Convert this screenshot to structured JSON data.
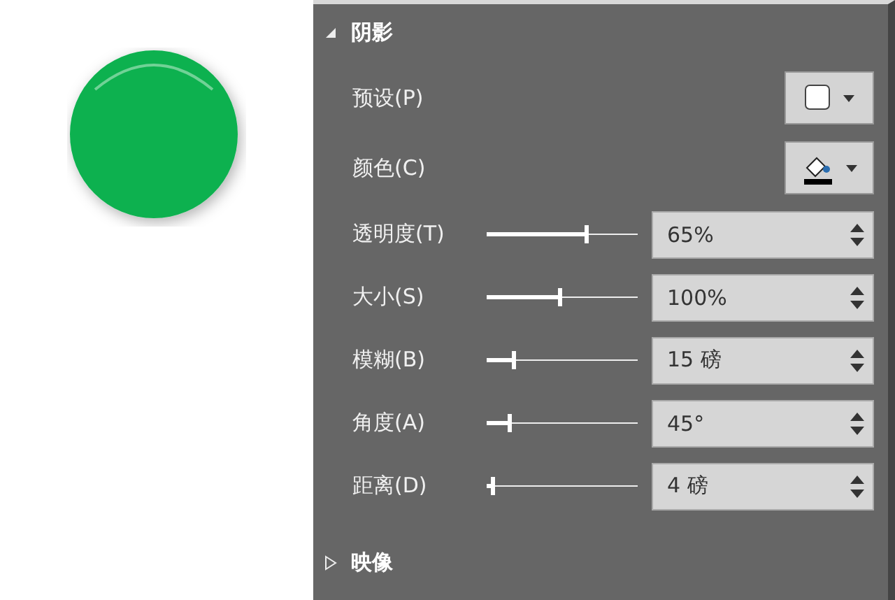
{
  "canvas": {
    "shape": {
      "kind": "circle",
      "color": "#0cb14f"
    }
  },
  "panel": {
    "shadow_section": {
      "title": "阴影",
      "expanded": true,
      "preset": {
        "label": "预设(P)"
      },
      "color": {
        "label": "颜色(C)"
      },
      "sliders": [
        {
          "label": "透明度(T)",
          "level": 0.67,
          "value": "65%"
        },
        {
          "label": "大小(S)",
          "level": 0.49,
          "value": "100%"
        },
        {
          "label": "模糊(B)",
          "level": 0.17,
          "value": "15 磅"
        },
        {
          "label": "角度(A)",
          "level": 0.14,
          "value": "45°"
        },
        {
          "label": "距离(D)",
          "level": 0.03,
          "value": "4 磅"
        }
      ]
    },
    "reflection_section": {
      "title": "映像",
      "expanded": false
    }
  }
}
